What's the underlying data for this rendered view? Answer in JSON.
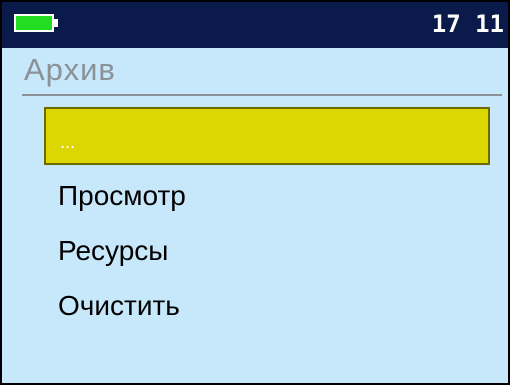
{
  "status_bar": {
    "battery_icon": "battery-full-icon",
    "battery_color": "#22dd22",
    "time": "17 11"
  },
  "screen": {
    "title": "Архив",
    "menu": [
      {
        "label": "...",
        "selected": true
      },
      {
        "label": "Просмотр",
        "selected": false
      },
      {
        "label": "Ресурсы",
        "selected": false
      },
      {
        "label": "Очистить",
        "selected": false
      }
    ]
  },
  "colors": {
    "background": "#c7e8fb",
    "status_bar": "#0a1a4a",
    "selection": "#dcd700",
    "title": "#8a9298"
  }
}
